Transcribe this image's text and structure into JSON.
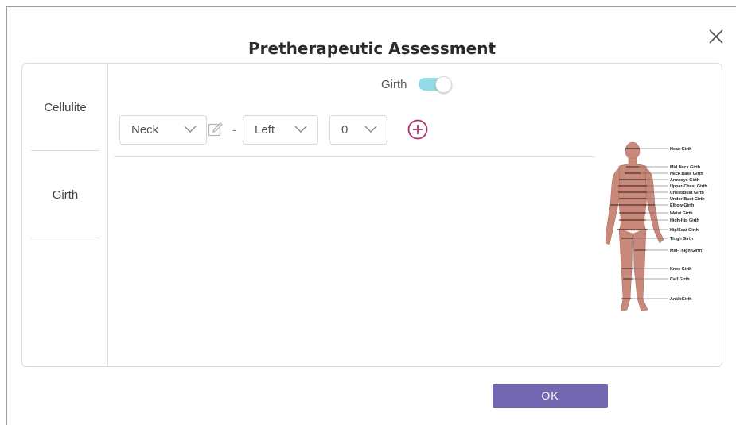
{
  "dialog": {
    "title": "Pretherapeutic Assessment"
  },
  "sidebar": {
    "items": [
      {
        "label": "Cellulite"
      },
      {
        "label": "Girth"
      }
    ]
  },
  "girth_toggle": {
    "label": "Girth",
    "on": true
  },
  "row": {
    "body_part": {
      "value": "Neck"
    },
    "separator": "-",
    "side": {
      "value": "Left"
    },
    "measure": {
      "value": "0"
    }
  },
  "diagram": {
    "labels": [
      "Head Girth",
      "Mid Neck Girth",
      "Neck Base Girth",
      "Armscye Girth",
      "Upper-Chest Girth",
      "Chest/Bust Girth",
      "Under-Bust Girth",
      "Elbow Girth",
      "Waist Girth",
      "High-Hip Girth",
      "Hip/Seat Girth",
      "Thigh Girth",
      "Mid-Thigh Girth",
      "Knee Girth",
      "Calf Girth",
      "AnkleGirth"
    ]
  },
  "footer": {
    "ok_label": "OK"
  },
  "colors": {
    "accent": "#7367b2",
    "toggle_track": "#93dbe7",
    "add_icon": "#b0306f"
  },
  "icons": [
    "close-icon",
    "chevron-down-icon",
    "edit-icon",
    "plus-circle-icon"
  ]
}
